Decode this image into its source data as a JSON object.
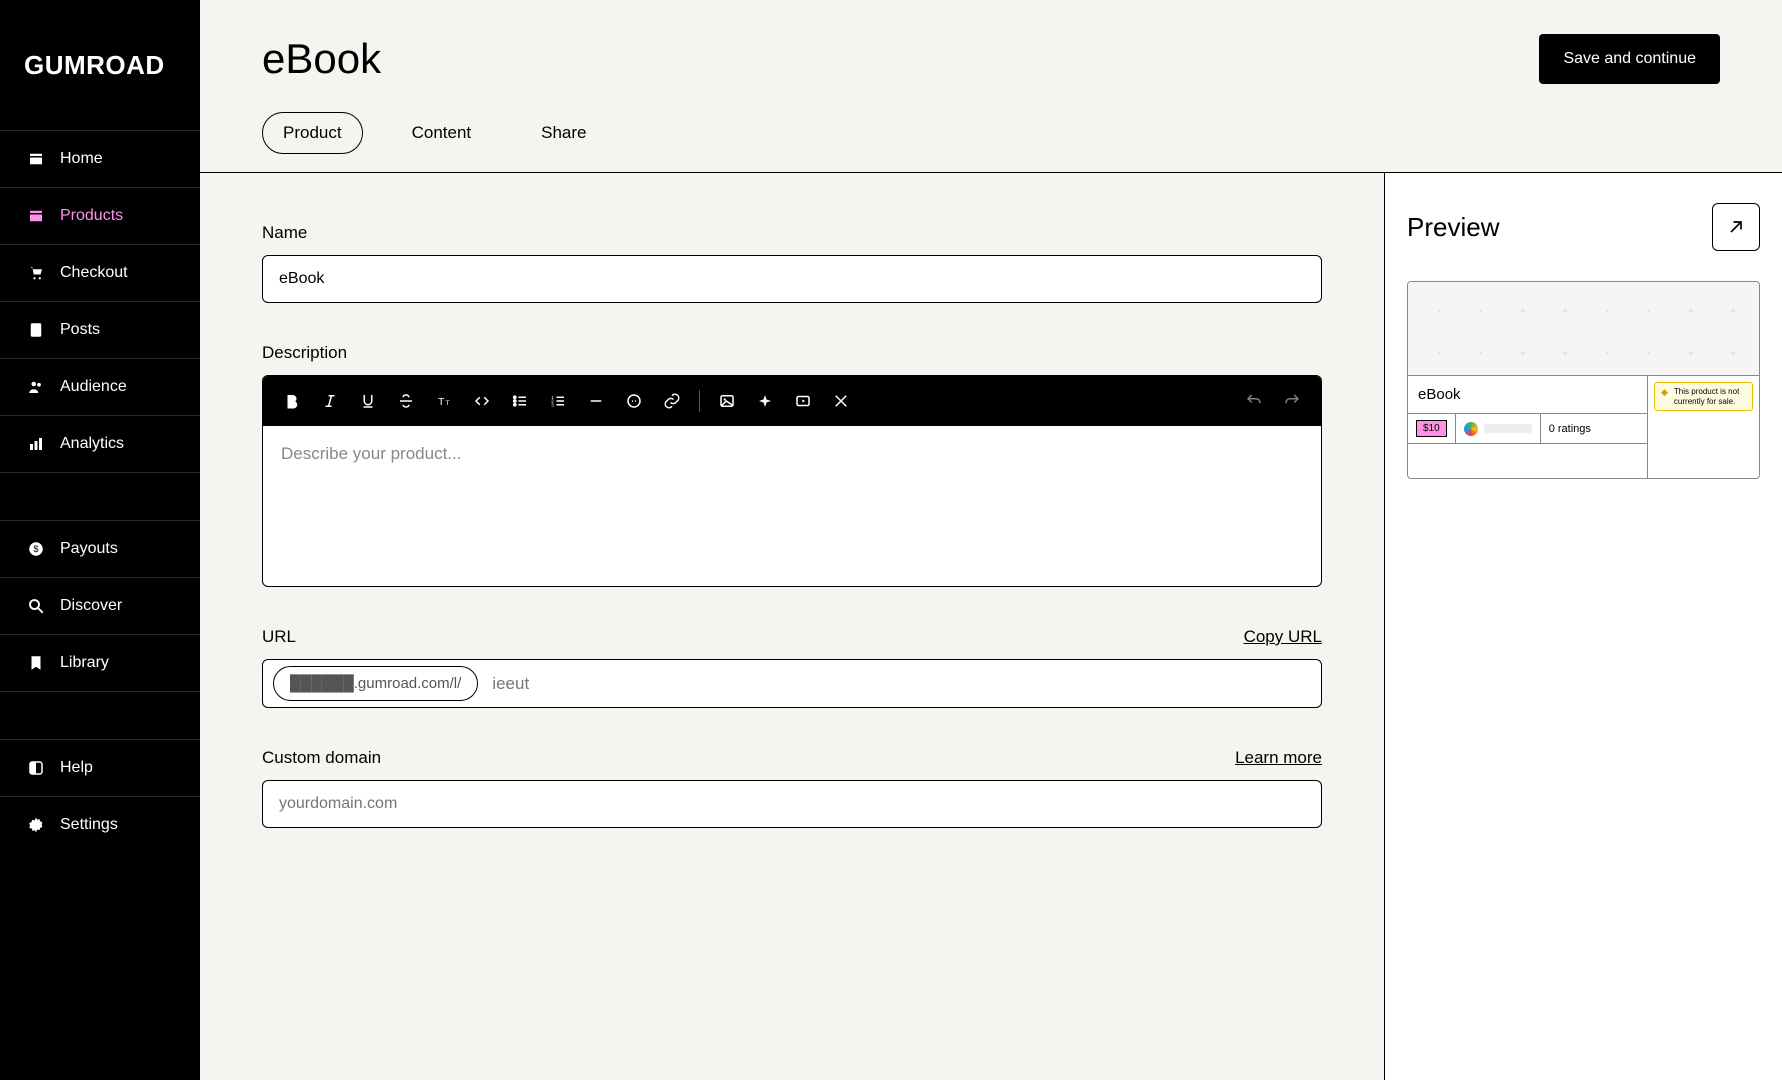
{
  "brand": "GUMROAD",
  "sidebar": {
    "items": [
      {
        "label": "Home",
        "active": false
      },
      {
        "label": "Products",
        "active": true
      },
      {
        "label": "Checkout",
        "active": false
      },
      {
        "label": "Posts",
        "active": false
      },
      {
        "label": "Audience",
        "active": false
      },
      {
        "label": "Analytics",
        "active": false
      }
    ],
    "items2": [
      {
        "label": "Payouts"
      },
      {
        "label": "Discover"
      },
      {
        "label": "Library"
      }
    ],
    "items3": [
      {
        "label": "Help"
      },
      {
        "label": "Settings"
      }
    ]
  },
  "header": {
    "title": "eBook",
    "save_label": "Save and continue",
    "tabs": [
      {
        "label": "Product",
        "active": true
      },
      {
        "label": "Content",
        "active": false
      },
      {
        "label": "Share",
        "active": false
      }
    ]
  },
  "form": {
    "name_label": "Name",
    "name_value": "eBook",
    "description_label": "Description",
    "description_placeholder": "Describe your product...",
    "url_label": "URL",
    "copy_url_label": "Copy URL",
    "url_prefix": "██████.gumroad.com/l/",
    "url_slug": "ieeut",
    "custom_domain_label": "Custom domain",
    "learn_more_label": "Learn more",
    "custom_domain_placeholder": "yourdomain.com"
  },
  "preview": {
    "heading": "Preview",
    "card_title": "eBook",
    "price": "$10",
    "ratings": "0 ratings",
    "notice": "This product is not currently for sale."
  }
}
